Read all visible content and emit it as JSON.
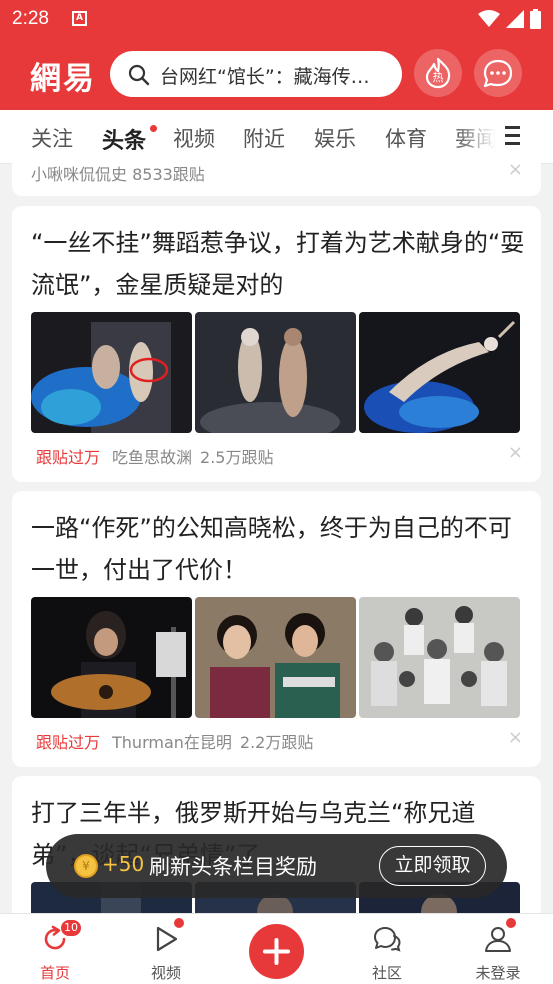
{
  "status_bar": {
    "time": "2:28",
    "notif_icon_letter": "A"
  },
  "header": {
    "logo": "網易",
    "search_placeholder": "台网红“馆长”：藏海传…",
    "hot_icon_label": "热"
  },
  "tabs": [
    {
      "label": "关注"
    },
    {
      "label": "头条"
    },
    {
      "label": "视频"
    },
    {
      "label": "附近"
    },
    {
      "label": "娱乐"
    },
    {
      "label": "体育"
    },
    {
      "label": "要闻"
    }
  ],
  "feed": {
    "partial": {
      "meta": "小啾咪侃侃史  8533跟贴"
    },
    "items": [
      {
        "title": "“一丝不挂”舞蹈惹争议，打着为艺术献身的“耍流氓”，金星质疑是对的",
        "tag": "跟贴过万",
        "source": "吃鱼思故渊",
        "comments": "2.5万跟贴"
      },
      {
        "title": "一路“作死”的公知高晓松，终于为自己的不可一世，付出了代价！",
        "tag": "跟贴过万",
        "source": "Thurman在昆明",
        "comments": "2.2万跟贴"
      },
      {
        "title": "打了三年半，俄罗斯开始与乌克兰“称兄道弟”，谈起“兄弟情”了"
      }
    ],
    "close_glyph": "×"
  },
  "toast": {
    "coin_glyph": "¥",
    "amount": "+50",
    "text": "刷新头条栏目奖励",
    "button": "立即领取"
  },
  "bottom_nav": {
    "items": [
      {
        "label": "首页",
        "badge": "10"
      },
      {
        "label": "视频"
      },
      {
        "label": "社区"
      },
      {
        "label": "未登录"
      }
    ]
  },
  "colors": {
    "brand_red": "#e8393a"
  }
}
